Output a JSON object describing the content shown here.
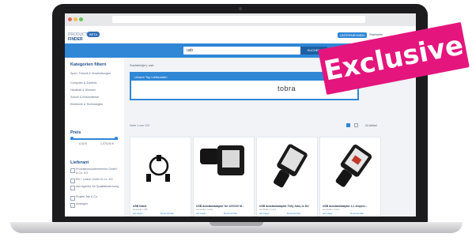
{
  "header": {
    "logo_line1": "PRODUCT",
    "logo_line2": "FINDER",
    "logo_badge": "BETA",
    "btn_primary": "UNTERNEHMEN",
    "btn_secondary": "Startseite"
  },
  "search": {
    "value": "usb",
    "button_label": "SUCHEN"
  },
  "sidebar": {
    "categories_title": "Kategorien filtern",
    "categories": [
      "Sport, Freizeit & Verarbeitungen",
      "Computer & Zubehör",
      "Haushalt & Wohnen",
      "Schule & Büromaterial",
      "Elektronik & Technologien"
    ],
    "price_title": "Preis",
    "price_min": "0.00 €",
    "price_max": "1.075,00 €",
    "suppliers_title": "Lieferant",
    "suppliers": [
      "Produktionsunternehmen GmbH & Co. KG",
      "EB + Leisch GmbH & Co. KG",
      "Adz Agentur für Qualitätswerbung",
      "Projekt Tab & Co.",
      "Anzeigen"
    ]
  },
  "main": {
    "results_text": "Suchfeld(er): usb",
    "banner_title": "Unsere Top Lieferanten",
    "banner_brand": "tobra",
    "count_text": "Seite 1 von 123",
    "per_page": "24 Artikel"
  },
  "products": [
    {
      "name": "USB Kabel",
      "brand": "Hersteller: BB",
      "status1": "auf Lager",
      "status2": "Reservierbar"
    },
    {
      "name": "USB Autoladeadapter für 12V/24V M...",
      "brand": "Hersteller: tobra",
      "status1": "auf Lager",
      "status2": "Reservierbar"
    },
    {
      "name": "USB Autoladeadapter Tefly Jobs,1x DU",
      "brand": "Hersteller: tobra",
      "status1": "auf Lager",
      "status2": "Reservierbar"
    },
    {
      "name": "USB Autoladeadapter 2,1 Ampere...",
      "brand": "Hersteller: tobra",
      "status1": "auf Lager",
      "status2": "Reservierbar"
    }
  ],
  "badge": {
    "label": "Exclusive"
  },
  "colors": {
    "accent": "#2f87d6",
    "badge": "#e4157d",
    "bezel": "#1c1c1e"
  }
}
